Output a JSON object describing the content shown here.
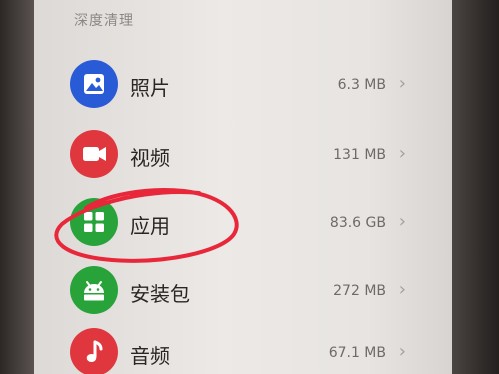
{
  "section": {
    "title": "深度清理"
  },
  "items": [
    {
      "label": "照片",
      "size": "6.3 MB",
      "icon": "photo-icon",
      "color": "#2a5bd7"
    },
    {
      "label": "视频",
      "size": "131 MB",
      "icon": "video-icon",
      "color": "#e0373f"
    },
    {
      "label": "应用",
      "size": "83.6 GB",
      "icon": "apps-icon",
      "color": "#27a33a"
    },
    {
      "label": "安装包",
      "size": "272 MB",
      "icon": "android-package-icon",
      "color": "#27a33a"
    },
    {
      "label": "音频",
      "size": "67.1 MB",
      "icon": "music-note-icon",
      "color": "#e0373f"
    }
  ],
  "annotation": {
    "color": "#e8283a",
    "target": "应用"
  },
  "chevron": "›"
}
